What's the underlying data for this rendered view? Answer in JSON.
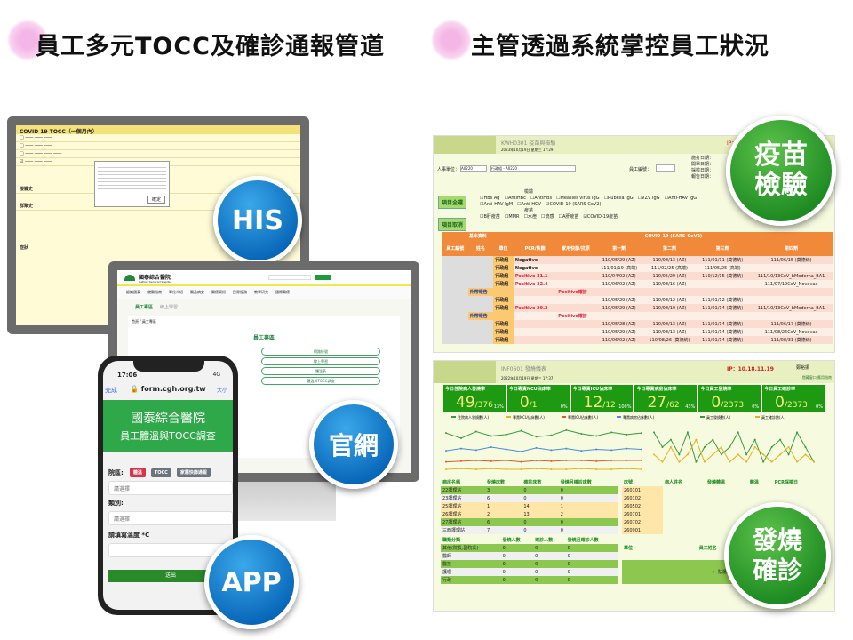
{
  "headings": {
    "left": "員工多元TOCC及確診通報管道",
    "right": "主管透過系統掌控員工狀況"
  },
  "badges": {
    "his": "HIS",
    "web": "官網",
    "app": "APP",
    "vaccine": "疫苗檢驗",
    "fever": "發燒確診"
  },
  "his": {
    "header": "COVID 19 TOCC（一個月內）",
    "sections": [
      "接觸史",
      "群聚史",
      "症狀"
    ],
    "dialog_btn": "確定"
  },
  "website": {
    "hospital": "國泰綜合醫院",
    "hospital_en": "Cathay General Hospital",
    "nav": [
      "認識國泰",
      "就醫指南",
      "單位介紹",
      "醫品病安",
      "醫療資訊",
      "民眾服務",
      "教學研究",
      "國際醫療"
    ],
    "tab1": "員工專區",
    "tab2": "線上學習",
    "breadcrumb": "首頁 / 員工專區",
    "section_title": "員工專區",
    "links": [
      "網路掛號",
      "線上學習",
      "體溫表",
      "體溫與TOCC調查"
    ]
  },
  "phone": {
    "time": "17:06",
    "signal": "4G",
    "back": "完成",
    "url": "form.cgh.org.tw",
    "text_size": "大小",
    "banner_line1": "國泰綜合醫院",
    "banner_line2": "員工體溫與TOCC調查",
    "campus_label": "院區:",
    "campus_buttons": [
      "體溫",
      "TOCC",
      "家屬快篩通報"
    ],
    "select_placeholder": "請選擇",
    "category_label": "類別:",
    "temp_label": "請填寫溫度 *C",
    "submit": "送出"
  },
  "vaccine": {
    "code": "KWH0301 疫苗與檢驗",
    "date": "2023年10月19日 星期三 17:29",
    "ip": "IP：",
    "unit_label": "人事單位：",
    "unit_code": "A0220",
    "unit_name": "行政組 - A0220",
    "emp_label": "員工編號：",
    "date_labels": [
      "施打日期：",
      "開單日期：",
      "採檢日期：",
      "報告日期："
    ],
    "select_all": "項目全選",
    "deselect": "項目取消",
    "test_group": "檢驗",
    "tests": [
      "HBs Ag",
      "AntiHBc",
      "AntiHBs",
      "Measles virus IgG",
      "Rubella IgG",
      "VZV IgG",
      "Anti-HAV IgG",
      "Anti-HAV IgM",
      "Anti-HCV",
      "COVID-19 (SARS-CoV2)"
    ],
    "vac_group": "疫苗",
    "vaccines": [
      "B肝疫苗",
      "MMR",
      "水痘",
      "流感",
      "A肝疫苗",
      "COVID-19疫苗"
    ],
    "group_basic": "基本資料",
    "group_covid": "COVID-19 (SARS-CoV2)",
    "columns": [
      "員工編號",
      "姓名",
      "單位",
      "PCR/快篩",
      "家用快篩/抗原",
      "第一劑",
      "第二劑",
      "第三劑",
      "第四劑"
    ],
    "rows": [
      [
        "",
        "",
        "行政組",
        "Negative",
        "",
        "110/05/29 (AZ)",
        "110/08/13 (AZ)",
        "111/01/11 (莫德納)",
        "111/06/15 (莫德納)"
      ],
      [
        "",
        "",
        "行政組",
        "Negative",
        "",
        "111/01/19 (高端)",
        "111/02/25 (高端)",
        "111/05/25 (高端)",
        ""
      ],
      [
        "",
        "",
        "行政組",
        "Positive 31.1",
        "",
        "110/04/02 (AZ)",
        "110/05/29 (AZ)",
        "110/12/15 (莫德納)",
        "111/10/13CoV_bModerna_BA1"
      ],
      [
        "",
        "",
        "行政組",
        "Positive 32.4",
        "",
        "110/06/02 (AZ)",
        "110/08/16 (AZ)",
        "",
        "111/07/19CoV_Novavax"
      ],
      [
        "",
        "外帶報告",
        "",
        "",
        "Positive確診",
        "",
        "",
        "",
        ""
      ],
      [
        "",
        "",
        "行政組",
        "",
        "",
        "110/05/29 (AZ)",
        "110/08/12 (AZ)",
        "111/01/12 (莫德納)",
        ""
      ],
      [
        "",
        "",
        "行政組",
        "Positive 29.3",
        "",
        "110/05/29 (AZ)",
        "110/08/10 (AZ)",
        "111/01/14 (莫德納)",
        "111/10/13CoV_bModerna_BA1"
      ],
      [
        "",
        "外帶報告",
        "",
        "",
        "Positive確診",
        "",
        "",
        "",
        ""
      ],
      [
        "",
        "",
        "行政組",
        "",
        "",
        "110/05/28 (AZ)",
        "110/08/13 (AZ)",
        "111/01/14 (莫德納)",
        "111/06/17 (莫德納)"
      ],
      [
        "",
        "",
        "行政組",
        "",
        "",
        "110/05/29 (AZ)",
        "110/08/13 (AZ)",
        "111/01/14 (莫德納)",
        "111/08/26CoV_Novavax"
      ],
      [
        "",
        "",
        "行政組",
        "",
        "",
        "110/06/02 (AZ)",
        "110/08/26 (莫德納)",
        "111/01/14 (莫德納)",
        "111/08/31 (莫德納)"
      ]
    ]
  },
  "fever": {
    "code": "INF0601 發燒儀表",
    "date": "2022年10月19日 星期三 17:37",
    "ip": "IP：10.18.11.19",
    "user": "鄭裕振",
    "links": "隱藏窗口 應用指南",
    "kpis": [
      {
        "label": "今日住院病人發燒率",
        "value": "49",
        "total": "/376",
        "pct": "13%"
      },
      {
        "label": "今日專責NCU佔床率",
        "value": "0",
        "total": "/1",
        "pct": "0%"
      },
      {
        "label": "今日專責ICU佔床率",
        "value": "12",
        "total": "/12",
        "pct": "100%"
      },
      {
        "label": "今日專責病房佔床率",
        "value": "27",
        "total": "/62",
        "pct": "43%"
      },
      {
        "label": "今日員工發燒率",
        "value": "0",
        "total": "/2373",
        "pct": "0%"
      },
      {
        "label": "今日員工確診率",
        "value": "0",
        "total": "/2373",
        "pct": "0%"
      }
    ],
    "legend_left": [
      "住院病人發燒數(人)",
      "專責NCU佔床數(人)",
      "專責ICU佔床數(人)",
      "專責病房佔床數(人)"
    ],
    "legend_right": [
      "員工發燒數(人)",
      "員工確診數(人)"
    ],
    "colors": {
      "s1": "#3a9a3a",
      "s2": "#e8b020",
      "s3": "#e05a2a",
      "s4": "#4a8ad8",
      "kpi": "#1e9a12"
    },
    "chart_left": {
      "s1": [
        49,
        42,
        51,
        45,
        47,
        52,
        44,
        46,
        53,
        48,
        45,
        50,
        47,
        49
      ],
      "s2": [
        0,
        1,
        0,
        1,
        0,
        0,
        1,
        0,
        0,
        1,
        0,
        0,
        1,
        0
      ],
      "s3": [
        10,
        11,
        12,
        11,
        12,
        10,
        12,
        11,
        12,
        12,
        11,
        12,
        12,
        12
      ],
      "s4": [
        25,
        28,
        26,
        30,
        27,
        24,
        29,
        26,
        28,
        25,
        27,
        26,
        28,
        27
      ]
    },
    "chart_right": {
      "s1": [
        5,
        3,
        4,
        2,
        5,
        1,
        3,
        4,
        2,
        3,
        5,
        2,
        4,
        1,
        3,
        4,
        2,
        5,
        3,
        1
      ],
      "s2": [
        2,
        1,
        3,
        1,
        2,
        4,
        1,
        2,
        3,
        1,
        2,
        1,
        3,
        2,
        1,
        2,
        3,
        1,
        2,
        1
      ]
    },
    "ward_columns": [
      "病房名稱",
      "發燒床數",
      "確診床數",
      "發燒且確診床數"
    ],
    "wards": [
      [
        "22護理站",
        "3",
        "0",
        "0"
      ],
      [
        "23護理站",
        "6",
        "0",
        "0"
      ],
      [
        "25護理站",
        "1",
        "14",
        "1"
      ],
      [
        "26護理站",
        "2",
        "13",
        "2"
      ],
      [
        "27護理站",
        "6",
        "0",
        "0"
      ],
      [
        "三西護理站",
        "7",
        "0",
        "0"
      ]
    ],
    "bed_columns": [
      "床號",
      "病人姓名",
      "發燒體溫",
      "體溫",
      "PCR採檢日"
    ],
    "beds": [
      "260101",
      "260102",
      "260502",
      "260701",
      "260702",
      "260901"
    ],
    "staff_columns": [
      "職類分類",
      "發燒人數",
      "確診人數",
      "發燒且確診人數"
    ],
    "staff": [
      [
        "其他(院長,副院長)",
        "0",
        "0",
        "0"
      ],
      [
        "醫師",
        "0",
        "0",
        "0"
      ],
      [
        "醫技",
        "0",
        "0",
        "0"
      ],
      [
        "護理",
        "0",
        "0",
        "0"
      ],
      [
        "行政",
        "0",
        "0",
        "0"
      ]
    ],
    "unit_columns": [
      "單位",
      "員工姓名"
    ],
    "unit_hint": "← 點選左側"
  }
}
